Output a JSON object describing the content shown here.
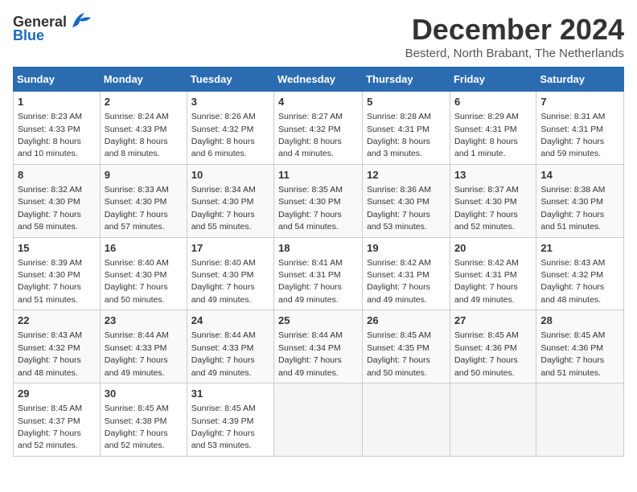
{
  "header": {
    "logo_line1": "General",
    "logo_line2": "Blue",
    "month": "December 2024",
    "location": "Besterd, North Brabant, The Netherlands"
  },
  "weekdays": [
    "Sunday",
    "Monday",
    "Tuesday",
    "Wednesday",
    "Thursday",
    "Friday",
    "Saturday"
  ],
  "weeks": [
    [
      {
        "day": 1,
        "sunrise": "8:23 AM",
        "sunset": "4:33 PM",
        "daylight": "8 hours and 10 minutes."
      },
      {
        "day": 2,
        "sunrise": "8:24 AM",
        "sunset": "4:33 PM",
        "daylight": "8 hours and 8 minutes."
      },
      {
        "day": 3,
        "sunrise": "8:26 AM",
        "sunset": "4:32 PM",
        "daylight": "8 hours and 6 minutes."
      },
      {
        "day": 4,
        "sunrise": "8:27 AM",
        "sunset": "4:32 PM",
        "daylight": "8 hours and 4 minutes."
      },
      {
        "day": 5,
        "sunrise": "8:28 AM",
        "sunset": "4:31 PM",
        "daylight": "8 hours and 3 minutes."
      },
      {
        "day": 6,
        "sunrise": "8:29 AM",
        "sunset": "4:31 PM",
        "daylight": "8 hours and 1 minute."
      },
      {
        "day": 7,
        "sunrise": "8:31 AM",
        "sunset": "4:31 PM",
        "daylight": "7 hours and 59 minutes."
      }
    ],
    [
      {
        "day": 8,
        "sunrise": "8:32 AM",
        "sunset": "4:30 PM",
        "daylight": "7 hours and 58 minutes."
      },
      {
        "day": 9,
        "sunrise": "8:33 AM",
        "sunset": "4:30 PM",
        "daylight": "7 hours and 57 minutes."
      },
      {
        "day": 10,
        "sunrise": "8:34 AM",
        "sunset": "4:30 PM",
        "daylight": "7 hours and 55 minutes."
      },
      {
        "day": 11,
        "sunrise": "8:35 AM",
        "sunset": "4:30 PM",
        "daylight": "7 hours and 54 minutes."
      },
      {
        "day": 12,
        "sunrise": "8:36 AM",
        "sunset": "4:30 PM",
        "daylight": "7 hours and 53 minutes."
      },
      {
        "day": 13,
        "sunrise": "8:37 AM",
        "sunset": "4:30 PM",
        "daylight": "7 hours and 52 minutes."
      },
      {
        "day": 14,
        "sunrise": "8:38 AM",
        "sunset": "4:30 PM",
        "daylight": "7 hours and 51 minutes."
      }
    ],
    [
      {
        "day": 15,
        "sunrise": "8:39 AM",
        "sunset": "4:30 PM",
        "daylight": "7 hours and 51 minutes."
      },
      {
        "day": 16,
        "sunrise": "8:40 AM",
        "sunset": "4:30 PM",
        "daylight": "7 hours and 50 minutes."
      },
      {
        "day": 17,
        "sunrise": "8:40 AM",
        "sunset": "4:30 PM",
        "daylight": "7 hours and 49 minutes."
      },
      {
        "day": 18,
        "sunrise": "8:41 AM",
        "sunset": "4:31 PM",
        "daylight": "7 hours and 49 minutes."
      },
      {
        "day": 19,
        "sunrise": "8:42 AM",
        "sunset": "4:31 PM",
        "daylight": "7 hours and 49 minutes."
      },
      {
        "day": 20,
        "sunrise": "8:42 AM",
        "sunset": "4:31 PM",
        "daylight": "7 hours and 49 minutes."
      },
      {
        "day": 21,
        "sunrise": "8:43 AM",
        "sunset": "4:32 PM",
        "daylight": "7 hours and 48 minutes."
      }
    ],
    [
      {
        "day": 22,
        "sunrise": "8:43 AM",
        "sunset": "4:32 PM",
        "daylight": "7 hours and 48 minutes."
      },
      {
        "day": 23,
        "sunrise": "8:44 AM",
        "sunset": "4:33 PM",
        "daylight": "7 hours and 49 minutes."
      },
      {
        "day": 24,
        "sunrise": "8:44 AM",
        "sunset": "4:33 PM",
        "daylight": "7 hours and 49 minutes."
      },
      {
        "day": 25,
        "sunrise": "8:44 AM",
        "sunset": "4:34 PM",
        "daylight": "7 hours and 49 minutes."
      },
      {
        "day": 26,
        "sunrise": "8:45 AM",
        "sunset": "4:35 PM",
        "daylight": "7 hours and 50 minutes."
      },
      {
        "day": 27,
        "sunrise": "8:45 AM",
        "sunset": "4:36 PM",
        "daylight": "7 hours and 50 minutes."
      },
      {
        "day": 28,
        "sunrise": "8:45 AM",
        "sunset": "4:36 PM",
        "daylight": "7 hours and 51 minutes."
      }
    ],
    [
      {
        "day": 29,
        "sunrise": "8:45 AM",
        "sunset": "4:37 PM",
        "daylight": "7 hours and 52 minutes."
      },
      {
        "day": 30,
        "sunrise": "8:45 AM",
        "sunset": "4:38 PM",
        "daylight": "7 hours and 52 minutes."
      },
      {
        "day": 31,
        "sunrise": "8:45 AM",
        "sunset": "4:39 PM",
        "daylight": "7 hours and 53 minutes."
      },
      null,
      null,
      null,
      null
    ]
  ]
}
